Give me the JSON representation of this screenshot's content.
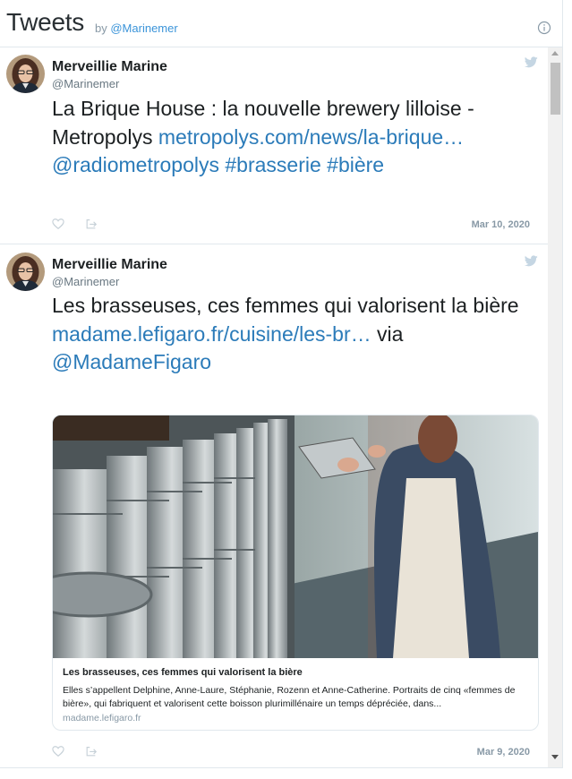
{
  "header": {
    "title": "Tweets",
    "by_prefix": "by",
    "by_handle": "@Marinemer"
  },
  "tweets": [
    {
      "author": "Merveillie Marine",
      "handle": "@Marinemer",
      "text_plain_1": "La Brique House : la nouvelle brewery lilloise - Metropolys ",
      "link_1": "metropolys.com/news/la-brique…",
      "link_2": "@radiometropolys",
      "link_3": "#brasserie",
      "link_4": "#bière",
      "date": "Mar 10, 2020"
    },
    {
      "author": "Merveillie Marine",
      "handle": "@Marinemer",
      "text_plain_1": "Les brasseuses, ces femmes qui valorisent la bière ",
      "link_1": "madame.lefigaro.fr/cuisine/les-br…",
      "text_plain_2": " via ",
      "link_2": "@MadameFigaro",
      "card": {
        "title": "Les brasseuses, ces femmes qui valorisent la bière",
        "description": "Elles s’appellent Delphine, Anne-Laure, Stéphanie, Rozenn et Anne-Catherine. Portraits de cinq «femmes de bière», qui fabriquent et valorisent cette boisson plurimillénaire un temps dépréciée, dans...",
        "domain": "madame.lefigaro.fr"
      },
      "date": "Mar 9, 2020"
    }
  ],
  "icons": {
    "info": "info-icon",
    "bird": "twitter-bird-icon",
    "like": "heart-icon",
    "share": "share-icon"
  },
  "colors": {
    "link": "#2b7bb9",
    "header_link": "#3b94d9",
    "muted": "#8899a6",
    "border": "#e1e8ed"
  }
}
